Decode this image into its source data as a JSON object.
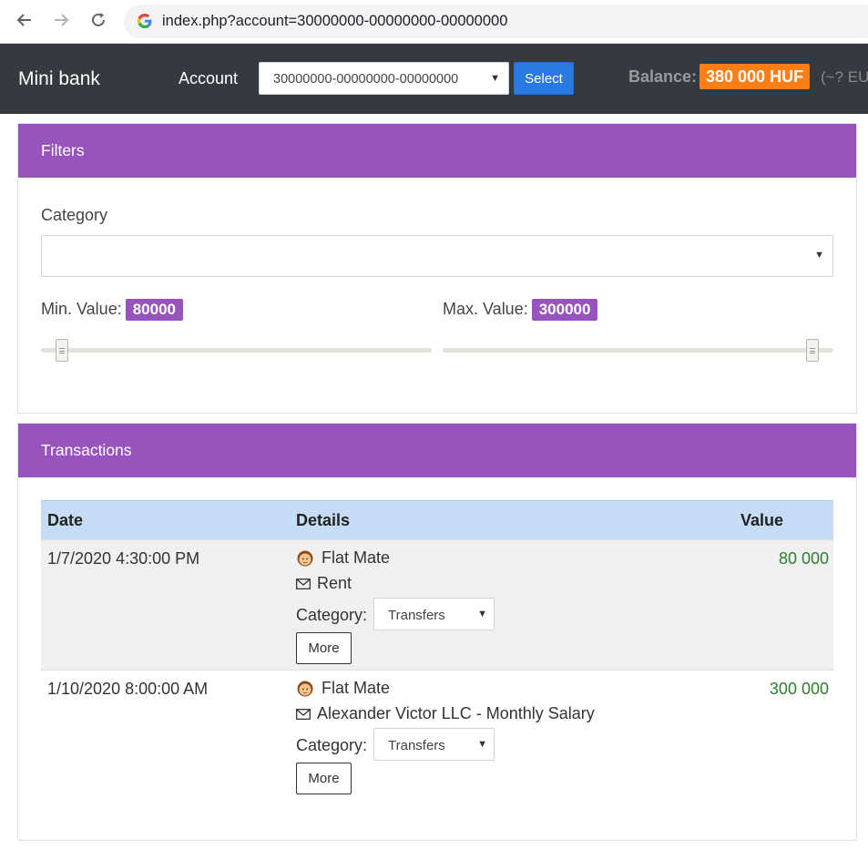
{
  "browser": {
    "url": "index.php?account=30000000-00000000-00000000"
  },
  "navbar": {
    "brand": "Mini bank",
    "account_label": "Account",
    "account_selected": "30000000-00000000-00000000",
    "select_button": "Select",
    "balance_label": "Balance:",
    "balance_value": "380 000 HUF",
    "balance_eur": "(~? EU"
  },
  "filters": {
    "title": "Filters",
    "category_label": "Category",
    "category_selected": "",
    "min_label": "Min. Value:",
    "min_value": "80000",
    "max_label": "Max. Value:",
    "max_value": "300000"
  },
  "transactions": {
    "title": "Transactions",
    "columns": {
      "date": "Date",
      "details": "Details",
      "value": "Value"
    },
    "rows": [
      {
        "date": "1/7/2020 4:30:00 PM",
        "partner": "Flat Mate",
        "message": "Rent",
        "category_label": "Category:",
        "category": "Transfers",
        "more": "More",
        "value": "80 000"
      },
      {
        "date": "1/10/2020 8:00:00 AM",
        "partner": "Flat Mate",
        "message": "Alexander Victor LLC - Monthly Salary",
        "category_label": "Category:",
        "category": "Transfers",
        "more": "More",
        "value": "300 000"
      }
    ]
  },
  "colors": {
    "navbar_bg": "#343a40",
    "card_header": "#9754bd",
    "balance_badge": "#fd7e14",
    "select_button": "#2a7ae2",
    "table_header": "#c5dcf4",
    "value_green": "#2e7d32"
  },
  "icons": [
    "back-arrow-icon",
    "forward-arrow-icon",
    "reload-icon",
    "google-icon",
    "person-icon",
    "envelope-icon",
    "caret-down-icon",
    "slider-grip-icon"
  ]
}
